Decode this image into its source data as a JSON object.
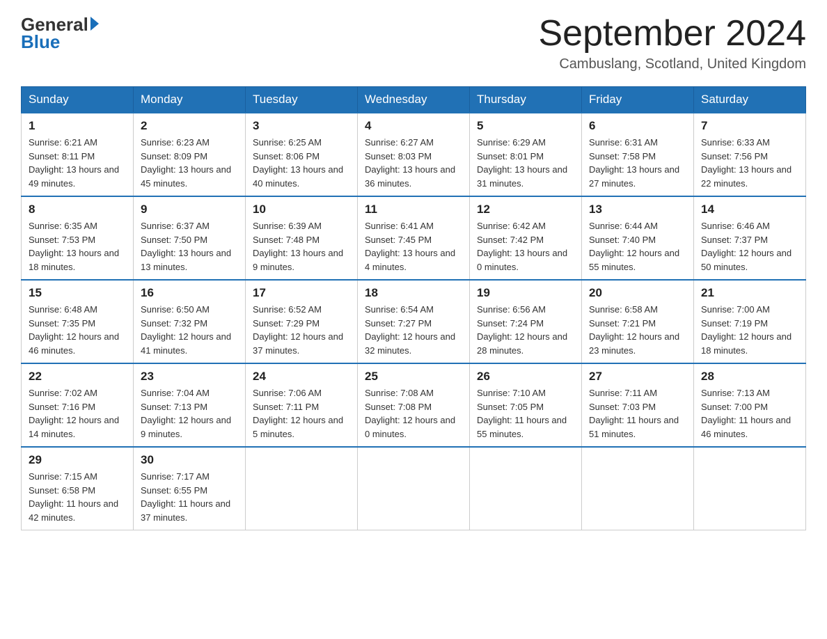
{
  "header": {
    "logo_general": "General",
    "logo_blue": "Blue",
    "month_title": "September 2024",
    "location": "Cambuslang, Scotland, United Kingdom"
  },
  "weekdays": [
    "Sunday",
    "Monday",
    "Tuesday",
    "Wednesday",
    "Thursday",
    "Friday",
    "Saturday"
  ],
  "weeks": [
    [
      {
        "day": "1",
        "sunrise": "Sunrise: 6:21 AM",
        "sunset": "Sunset: 8:11 PM",
        "daylight": "Daylight: 13 hours and 49 minutes."
      },
      {
        "day": "2",
        "sunrise": "Sunrise: 6:23 AM",
        "sunset": "Sunset: 8:09 PM",
        "daylight": "Daylight: 13 hours and 45 minutes."
      },
      {
        "day": "3",
        "sunrise": "Sunrise: 6:25 AM",
        "sunset": "Sunset: 8:06 PM",
        "daylight": "Daylight: 13 hours and 40 minutes."
      },
      {
        "day": "4",
        "sunrise": "Sunrise: 6:27 AM",
        "sunset": "Sunset: 8:03 PM",
        "daylight": "Daylight: 13 hours and 36 minutes."
      },
      {
        "day": "5",
        "sunrise": "Sunrise: 6:29 AM",
        "sunset": "Sunset: 8:01 PM",
        "daylight": "Daylight: 13 hours and 31 minutes."
      },
      {
        "day": "6",
        "sunrise": "Sunrise: 6:31 AM",
        "sunset": "Sunset: 7:58 PM",
        "daylight": "Daylight: 13 hours and 27 minutes."
      },
      {
        "day": "7",
        "sunrise": "Sunrise: 6:33 AM",
        "sunset": "Sunset: 7:56 PM",
        "daylight": "Daylight: 13 hours and 22 minutes."
      }
    ],
    [
      {
        "day": "8",
        "sunrise": "Sunrise: 6:35 AM",
        "sunset": "Sunset: 7:53 PM",
        "daylight": "Daylight: 13 hours and 18 minutes."
      },
      {
        "day": "9",
        "sunrise": "Sunrise: 6:37 AM",
        "sunset": "Sunset: 7:50 PM",
        "daylight": "Daylight: 13 hours and 13 minutes."
      },
      {
        "day": "10",
        "sunrise": "Sunrise: 6:39 AM",
        "sunset": "Sunset: 7:48 PM",
        "daylight": "Daylight: 13 hours and 9 minutes."
      },
      {
        "day": "11",
        "sunrise": "Sunrise: 6:41 AM",
        "sunset": "Sunset: 7:45 PM",
        "daylight": "Daylight: 13 hours and 4 minutes."
      },
      {
        "day": "12",
        "sunrise": "Sunrise: 6:42 AM",
        "sunset": "Sunset: 7:42 PM",
        "daylight": "Daylight: 13 hours and 0 minutes."
      },
      {
        "day": "13",
        "sunrise": "Sunrise: 6:44 AM",
        "sunset": "Sunset: 7:40 PM",
        "daylight": "Daylight: 12 hours and 55 minutes."
      },
      {
        "day": "14",
        "sunrise": "Sunrise: 6:46 AM",
        "sunset": "Sunset: 7:37 PM",
        "daylight": "Daylight: 12 hours and 50 minutes."
      }
    ],
    [
      {
        "day": "15",
        "sunrise": "Sunrise: 6:48 AM",
        "sunset": "Sunset: 7:35 PM",
        "daylight": "Daylight: 12 hours and 46 minutes."
      },
      {
        "day": "16",
        "sunrise": "Sunrise: 6:50 AM",
        "sunset": "Sunset: 7:32 PM",
        "daylight": "Daylight: 12 hours and 41 minutes."
      },
      {
        "day": "17",
        "sunrise": "Sunrise: 6:52 AM",
        "sunset": "Sunset: 7:29 PM",
        "daylight": "Daylight: 12 hours and 37 minutes."
      },
      {
        "day": "18",
        "sunrise": "Sunrise: 6:54 AM",
        "sunset": "Sunset: 7:27 PM",
        "daylight": "Daylight: 12 hours and 32 minutes."
      },
      {
        "day": "19",
        "sunrise": "Sunrise: 6:56 AM",
        "sunset": "Sunset: 7:24 PM",
        "daylight": "Daylight: 12 hours and 28 minutes."
      },
      {
        "day": "20",
        "sunrise": "Sunrise: 6:58 AM",
        "sunset": "Sunset: 7:21 PM",
        "daylight": "Daylight: 12 hours and 23 minutes."
      },
      {
        "day": "21",
        "sunrise": "Sunrise: 7:00 AM",
        "sunset": "Sunset: 7:19 PM",
        "daylight": "Daylight: 12 hours and 18 minutes."
      }
    ],
    [
      {
        "day": "22",
        "sunrise": "Sunrise: 7:02 AM",
        "sunset": "Sunset: 7:16 PM",
        "daylight": "Daylight: 12 hours and 14 minutes."
      },
      {
        "day": "23",
        "sunrise": "Sunrise: 7:04 AM",
        "sunset": "Sunset: 7:13 PM",
        "daylight": "Daylight: 12 hours and 9 minutes."
      },
      {
        "day": "24",
        "sunrise": "Sunrise: 7:06 AM",
        "sunset": "Sunset: 7:11 PM",
        "daylight": "Daylight: 12 hours and 5 minutes."
      },
      {
        "day": "25",
        "sunrise": "Sunrise: 7:08 AM",
        "sunset": "Sunset: 7:08 PM",
        "daylight": "Daylight: 12 hours and 0 minutes."
      },
      {
        "day": "26",
        "sunrise": "Sunrise: 7:10 AM",
        "sunset": "Sunset: 7:05 PM",
        "daylight": "Daylight: 11 hours and 55 minutes."
      },
      {
        "day": "27",
        "sunrise": "Sunrise: 7:11 AM",
        "sunset": "Sunset: 7:03 PM",
        "daylight": "Daylight: 11 hours and 51 minutes."
      },
      {
        "day": "28",
        "sunrise": "Sunrise: 7:13 AM",
        "sunset": "Sunset: 7:00 PM",
        "daylight": "Daylight: 11 hours and 46 minutes."
      }
    ],
    [
      {
        "day": "29",
        "sunrise": "Sunrise: 7:15 AM",
        "sunset": "Sunset: 6:58 PM",
        "daylight": "Daylight: 11 hours and 42 minutes."
      },
      {
        "day": "30",
        "sunrise": "Sunrise: 7:17 AM",
        "sunset": "Sunset: 6:55 PM",
        "daylight": "Daylight: 11 hours and 37 minutes."
      },
      null,
      null,
      null,
      null,
      null
    ]
  ]
}
